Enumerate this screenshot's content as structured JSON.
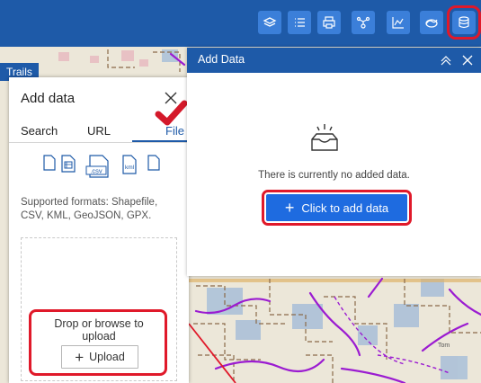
{
  "colors": {
    "toolbar": "#1e5aa8",
    "toolbar_button": "#3b7fd9",
    "accent": "#1e6be0",
    "highlight": "#e0192a",
    "trail_line": "#9b1bd1"
  },
  "toolbar": {
    "buttons": [
      {
        "icon": "layers-icon"
      },
      {
        "icon": "legend-icon"
      },
      {
        "icon": "print-icon"
      },
      {
        "icon": "share-icon"
      },
      {
        "icon": "chart-icon"
      },
      {
        "icon": "basemap-icon"
      },
      {
        "icon": "database-icon"
      }
    ]
  },
  "map": {
    "layer_label": "Trails"
  },
  "add_data_panel": {
    "title": "Add data",
    "tabs": [
      {
        "label": "Search"
      },
      {
        "label": "URL"
      },
      {
        "label": "File"
      }
    ],
    "active_tab": "File",
    "file_type_icons": [
      "file-icon",
      "shapefile-icon",
      "csv-icon",
      "kml-icon",
      "file-icon"
    ],
    "csv_label": ".csv",
    "kml_label": "kml",
    "supported_formats": "Supported formats: Shapefile, CSV, KML, GeoJSON, GPX.",
    "dropzone_text": "Drop or browse to upload",
    "upload_label": "Upload"
  },
  "add_data_widget": {
    "title": "Add Data",
    "empty_message": "There is currently no added data.",
    "add_button_label": "Click to add data"
  }
}
